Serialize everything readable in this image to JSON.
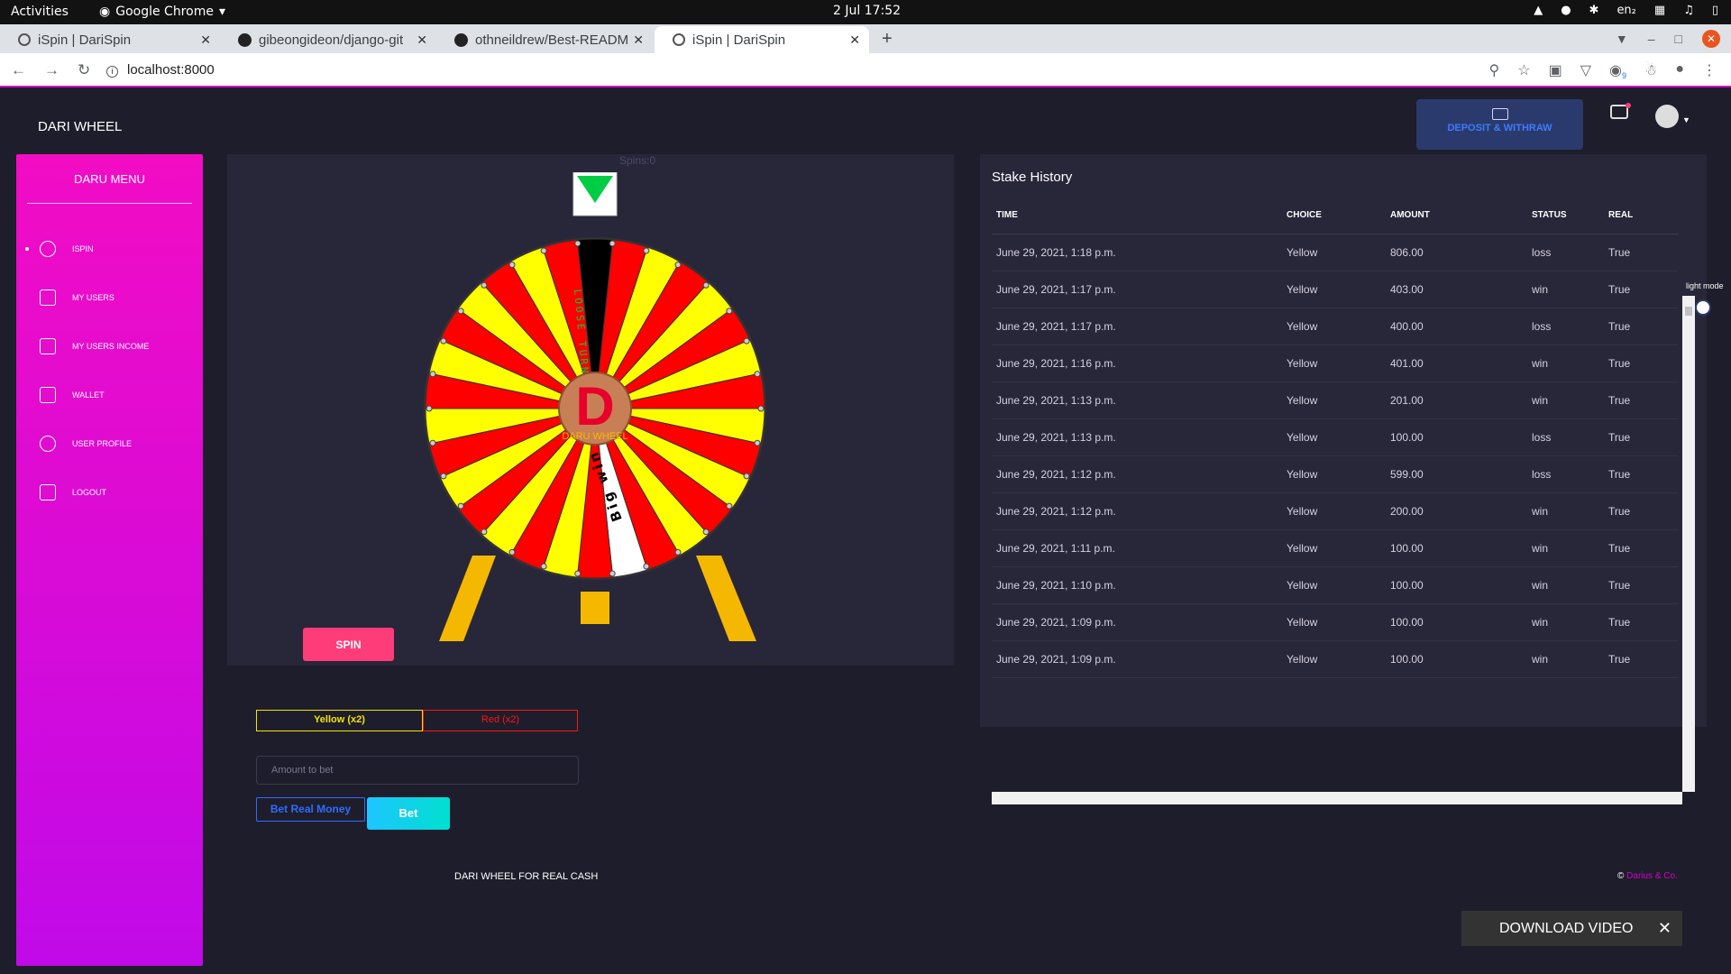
{
  "os": {
    "activities": "Activities",
    "app": "Google Chrome",
    "clock": "2 Jul  17:52",
    "lang": "en₂"
  },
  "tabs": [
    {
      "title": "iSpin | DariSpin",
      "active": false
    },
    {
      "title": "gibeongideon/django-git",
      "active": false
    },
    {
      "title": "othneildrew/Best-READM",
      "active": false
    },
    {
      "title": "iSpin | DariSpin",
      "active": true
    }
  ],
  "address": {
    "url": "localhost:8000",
    "extension_badge": "9"
  },
  "header": {
    "brand": "DARI WHEEL",
    "deposit_label": "DEPOSIT & WITHRAW"
  },
  "sidebar": {
    "title": "DARU MENU",
    "items": [
      {
        "label": "ISPIN",
        "icon": "wheel-icon"
      },
      {
        "label": "MY USERS",
        "icon": "id-card-icon"
      },
      {
        "label": "MY USERS INCOME",
        "icon": "id-card-icon"
      },
      {
        "label": "WALLET",
        "icon": "wallet-icon"
      },
      {
        "label": "USER PROFILE",
        "icon": "user-icon"
      },
      {
        "label": "LOGOUT",
        "icon": "runner-icon"
      }
    ]
  },
  "wheel": {
    "spins_label": "Spins:0",
    "loose_label": "LOOSE TURN",
    "bigwin_label": "Big win",
    "center_label": "DARU WHEEL",
    "spin_button": "SPIN",
    "colors": {
      "yellow": "#ffff00",
      "red": "#ff0000",
      "black": "#000000",
      "white": "#ffffff",
      "hub": "#c87f56",
      "pointer": "#00cc44",
      "stand": "#f5b800"
    }
  },
  "bet": {
    "yellow_choice": "Yellow (x2)",
    "red_choice": "Red (x2)",
    "amount_placeholder": "Amount to bet",
    "bet_real": "Bet Real Money",
    "bet": "Bet"
  },
  "stake": {
    "title": "Stake History",
    "columns": [
      "TIME",
      "CHOICE",
      "AMOUNT",
      "STATUS",
      "REAL"
    ],
    "rows": [
      [
        "June 29, 2021, 1:18 p.m.",
        "Yellow",
        "806.00",
        "loss",
        "True"
      ],
      [
        "June 29, 2021, 1:17 p.m.",
        "Yellow",
        "403.00",
        "win",
        "True"
      ],
      [
        "June 29, 2021, 1:17 p.m.",
        "Yellow",
        "400.00",
        "loss",
        "True"
      ],
      [
        "June 29, 2021, 1:16 p.m.",
        "Yellow",
        "401.00",
        "win",
        "True"
      ],
      [
        "June 29, 2021, 1:13 p.m.",
        "Yellow",
        "201.00",
        "win",
        "True"
      ],
      [
        "June 29, 2021, 1:13 p.m.",
        "Yellow",
        "100.00",
        "loss",
        "True"
      ],
      [
        "June 29, 2021, 1:12 p.m.",
        "Yellow",
        "599.00",
        "loss",
        "True"
      ],
      [
        "June 29, 2021, 1:12 p.m.",
        "Yellow",
        "200.00",
        "win",
        "True"
      ],
      [
        "June 29, 2021, 1:11 p.m.",
        "Yellow",
        "100.00",
        "win",
        "True"
      ],
      [
        "June 29, 2021, 1:10 p.m.",
        "Yellow",
        "100.00",
        "win",
        "True"
      ],
      [
        "June 29, 2021, 1:09 p.m.",
        "Yellow",
        "100.00",
        "win",
        "True"
      ],
      [
        "June 29, 2021, 1:09 p.m.",
        "Yellow",
        "100.00",
        "win",
        "True"
      ]
    ]
  },
  "theme_toggle": "light mode",
  "footer": {
    "left": "DARI WHEEL FOR REAL CASH",
    "copy_symbol": "©",
    "copy_link": "Darius & Co."
  },
  "download": {
    "label": "DOWNLOAD VIDEO",
    "close": "✕"
  }
}
